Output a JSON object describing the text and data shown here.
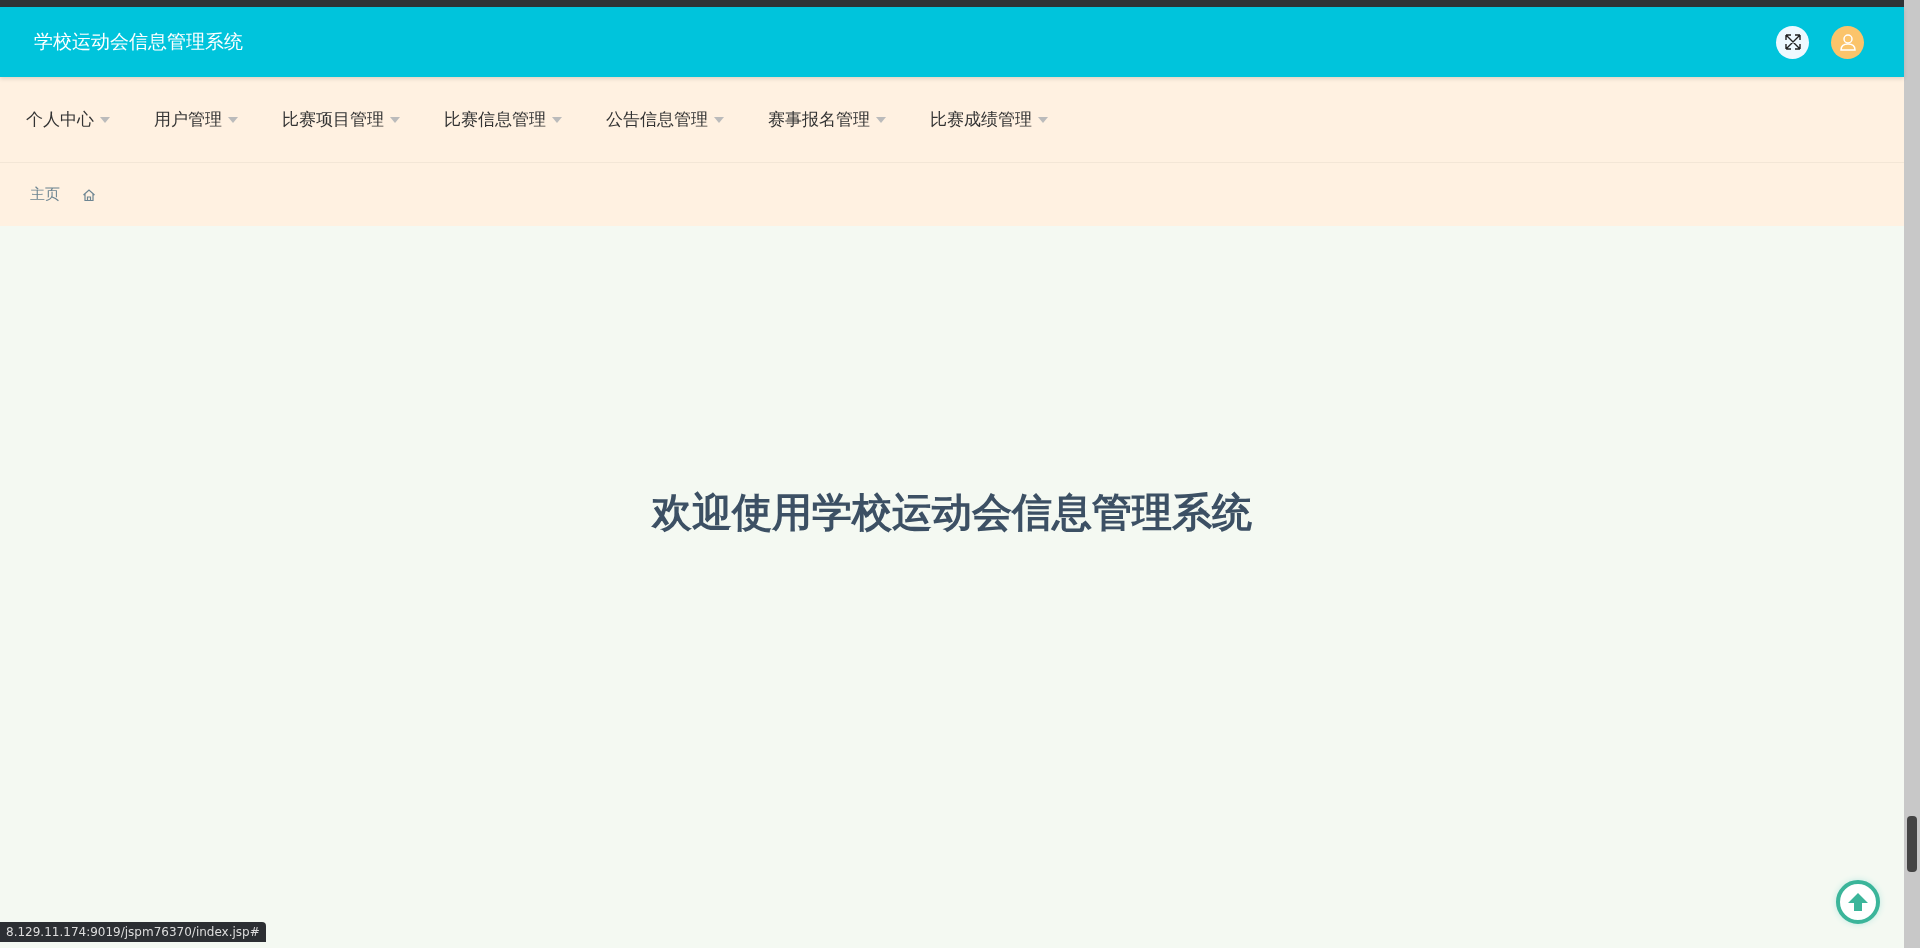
{
  "header": {
    "title": "学校运动会信息管理系统"
  },
  "nav": {
    "items": [
      {
        "label": "个人中心"
      },
      {
        "label": "用户管理"
      },
      {
        "label": "比赛项目管理"
      },
      {
        "label": "比赛信息管理"
      },
      {
        "label": "公告信息管理"
      },
      {
        "label": "赛事报名管理"
      },
      {
        "label": "比赛成绩管理"
      }
    ]
  },
  "breadcrumb": {
    "label": "主页"
  },
  "main": {
    "welcome": "欢迎使用学校运动会信息管理系统"
  },
  "status_bar": {
    "url": "8.129.11.174:9019/jspm76370/index.jsp#"
  }
}
